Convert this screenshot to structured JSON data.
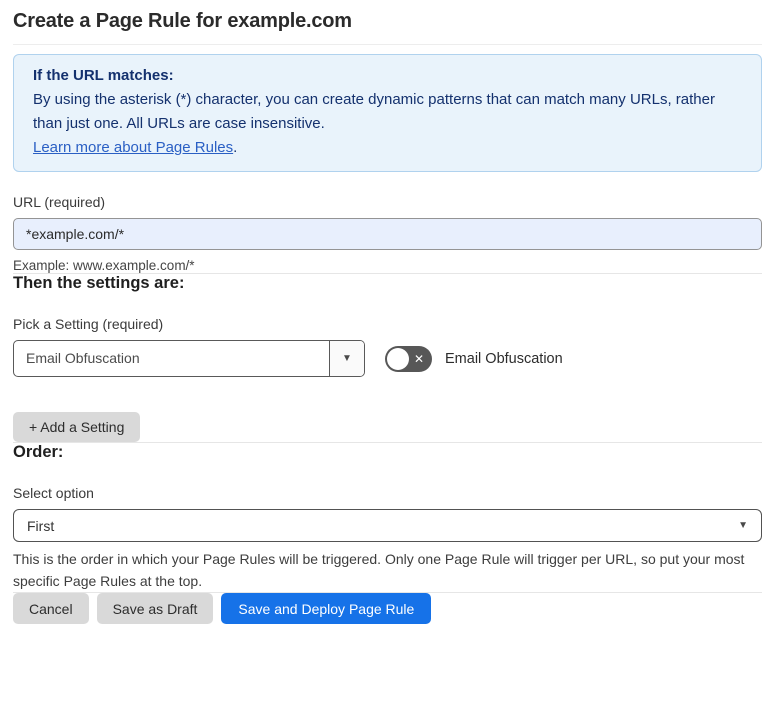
{
  "page": {
    "title": "Create a Page Rule for example.com"
  },
  "info_box": {
    "heading": "If the URL matches:",
    "body": "By using the asterisk (*) character, you can create dynamic patterns that can match many URLs, rather than just one. All URLs are case insensitive.",
    "link_label": "Learn more about Page Rules",
    "link_suffix": "."
  },
  "url_field": {
    "label": "URL (required)",
    "value": "*example.com/*",
    "helper": "Example: www.example.com/*"
  },
  "settings_section": {
    "heading": "Then the settings are:",
    "pick_label": "Pick a Setting (required)",
    "selected_setting": "Email Obfuscation",
    "toggle": {
      "state": "off",
      "label": "Email Obfuscation",
      "off_glyph": "✕"
    },
    "add_setting_label": "+ Add a Setting"
  },
  "order_section": {
    "heading": "Order:",
    "select_label": "Select option",
    "selected_option": "First",
    "helper": "This is the order in which your Page Rules will be triggered. Only one Page Rule will trigger per URL, so put your most specific Page Rules at the top."
  },
  "footer": {
    "cancel_label": "Cancel",
    "save_draft_label": "Save as Draft",
    "save_deploy_label": "Save and Deploy Page Rule"
  },
  "icons": {
    "dropdown_arrow": "▼",
    "select_arrow": "▼"
  },
  "colors": {
    "info_bg": "#e9f3fb",
    "info_border": "#b0d2ee",
    "info_text": "#14316e",
    "link": "#2a5fc4",
    "input_bg": "#e8effd",
    "primary_button": "#1672e8",
    "gray_button": "#d9d9d9",
    "toggle_off": "#575757"
  }
}
